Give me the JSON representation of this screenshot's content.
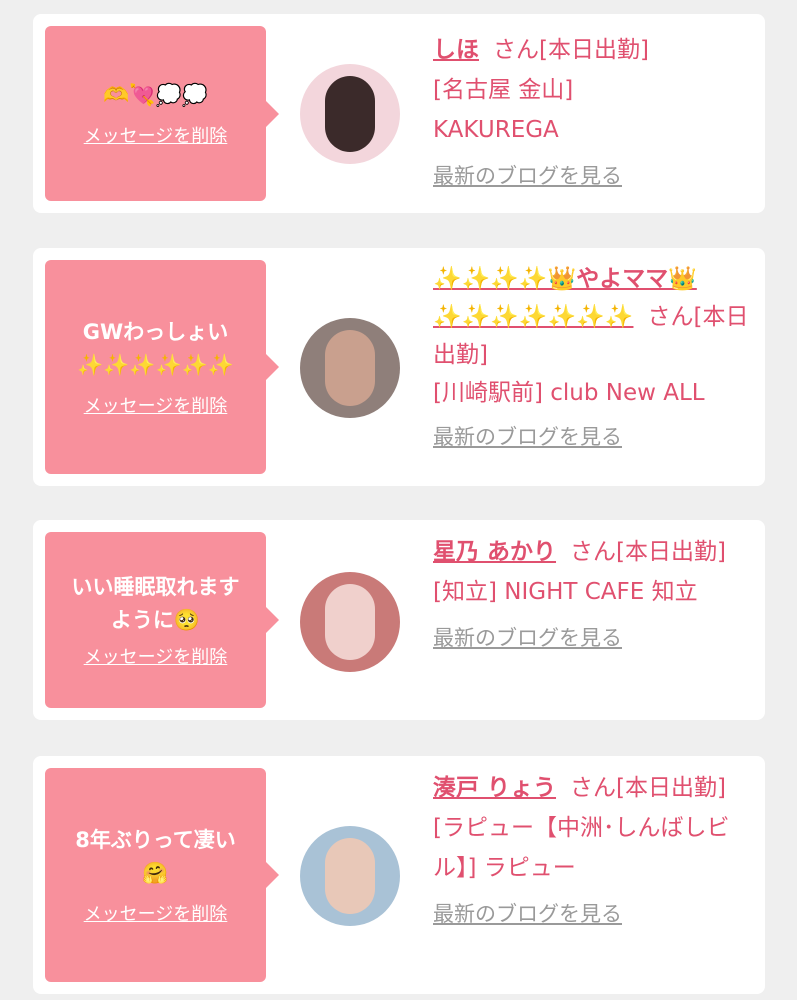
{
  "messages": [
    {
      "bubble_lines": [
        "🫶💘💭💭"
      ],
      "delete_label": "メッセージを削除",
      "name": "しほ",
      "suffix": "さん[本日出勤]",
      "store": "[名古屋 金山] KAKUREGA",
      "blog_label": "最新のブログを見る",
      "avatar_colors": [
        "#f3d6dc",
        "#3b2a2a"
      ]
    },
    {
      "bubble_lines": [
        "GWわっしょい",
        "✨✨✨✨✨✨"
      ],
      "delete_label": "メッセージを削除",
      "name": "✨✨✨✨👑やよママ👑✨✨✨✨✨✨✨",
      "suffix": "さん[本日出勤]",
      "store": "[川崎駅前] club New ALL",
      "blog_label": "最新のブログを見る",
      "avatar_colors": [
        "#8f7f7a",
        "#c9a08e"
      ]
    },
    {
      "bubble_lines": [
        "いい睡眠取れます",
        "ように🥺"
      ],
      "delete_label": "メッセージを削除",
      "name": "星乃 あかり",
      "suffix": "さん[本日出勤]",
      "store": "[知立] NIGHT CAFE 知立",
      "blog_label": "最新のブログを見る",
      "avatar_colors": [
        "#c97a78",
        "#f0d0cc"
      ]
    },
    {
      "bubble_lines": [
        "8年ぶりって凄い",
        "🤗"
      ],
      "delete_label": "メッセージを削除",
      "name": "湊戸 りょう",
      "suffix": "さん[本日出勤]",
      "store": "[ラピュー【中洲･しんばしビル】] ラピュー",
      "blog_label": "最新のブログを見る",
      "avatar_colors": [
        "#a9c2d6",
        "#e8c8b8"
      ]
    }
  ]
}
